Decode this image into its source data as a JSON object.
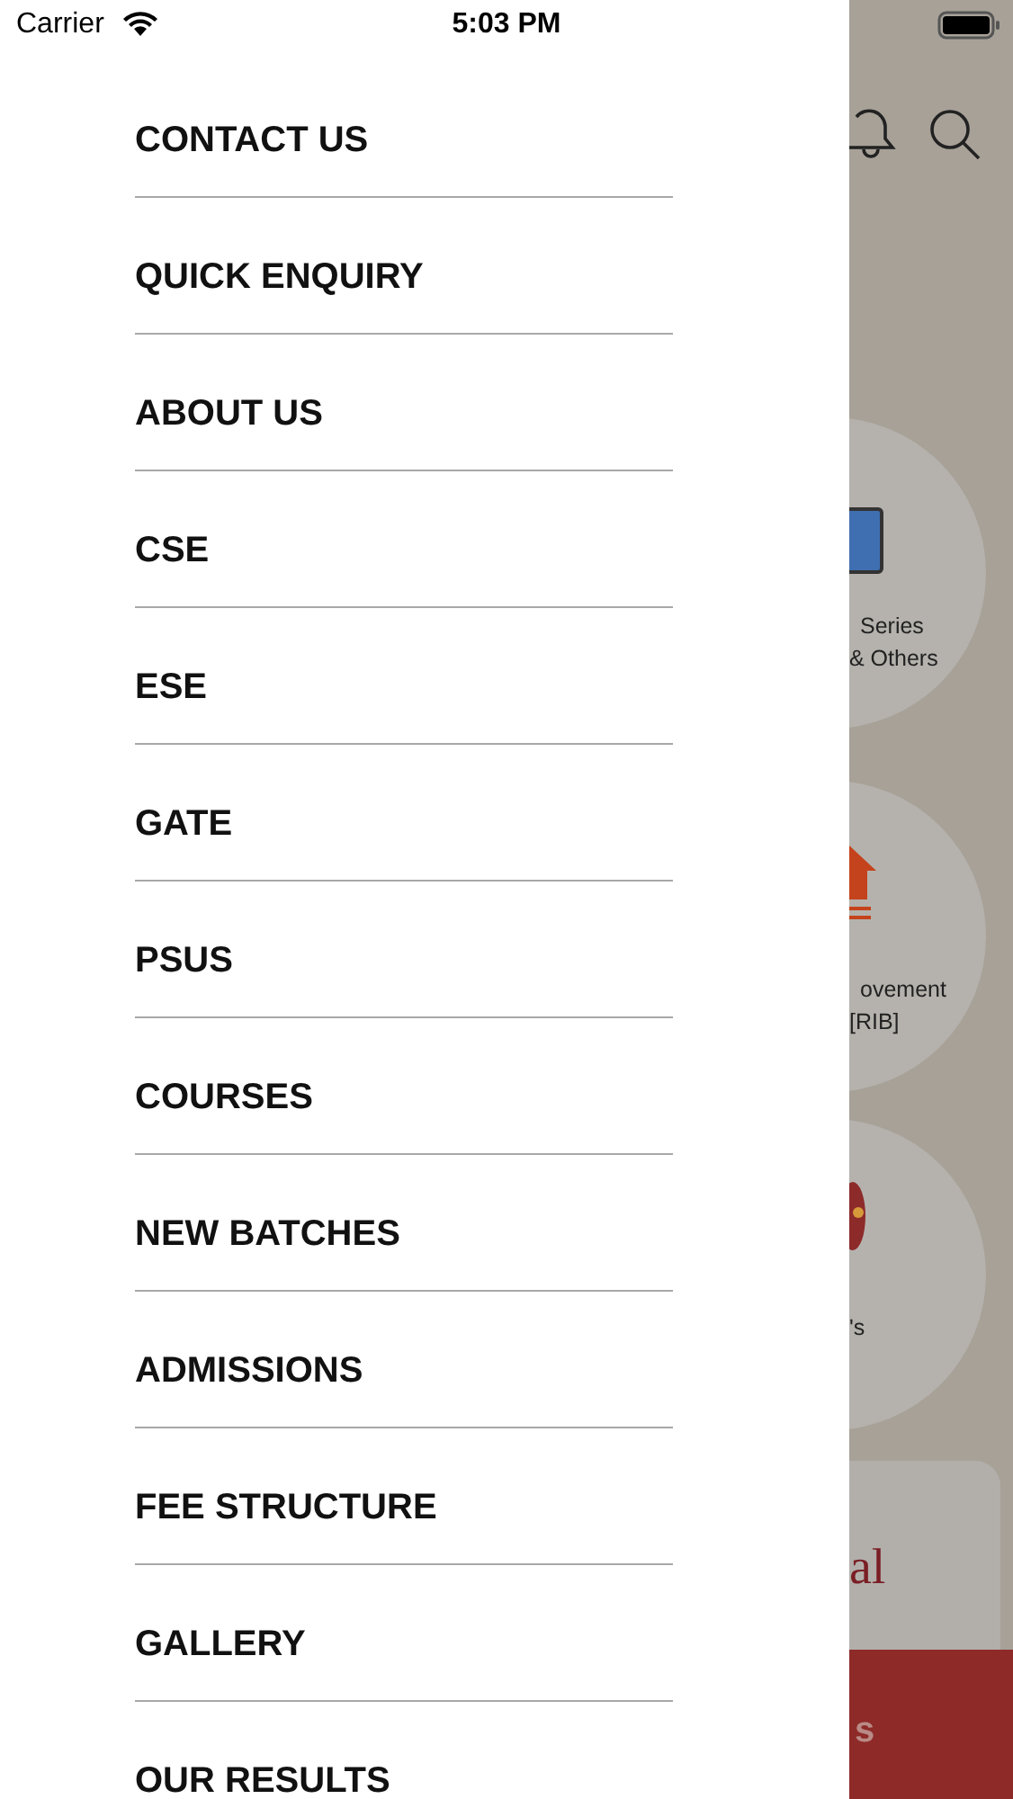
{
  "status_bar": {
    "carrier": "Carrier",
    "time": "5:03 PM"
  },
  "menu": {
    "items": [
      {
        "label": "CONTACT US"
      },
      {
        "label": "QUICK ENQUIRY"
      },
      {
        "label": "ABOUT US"
      },
      {
        "label": "CSE"
      },
      {
        "label": "ESE"
      },
      {
        "label": "GATE"
      },
      {
        "label": "PSUS"
      },
      {
        "label": "COURSES"
      },
      {
        "label": "NEW BATCHES"
      },
      {
        "label": "ADMISSIONS"
      },
      {
        "label": "FEE STRUCTURE"
      },
      {
        "label": "GALLERY"
      },
      {
        "label": "OUR RESULTS"
      }
    ]
  },
  "background_page": {
    "tiles": [
      {
        "kind": "tablet",
        "lines": [
          "Series",
          "& Others"
        ]
      },
      {
        "kind": "arrow",
        "lines": [
          "ovement",
          "[RIB]"
        ]
      },
      {
        "kind": "badge",
        "lines": [
          "'s"
        ]
      }
    ],
    "card_text": "al",
    "banner_text": "s"
  }
}
